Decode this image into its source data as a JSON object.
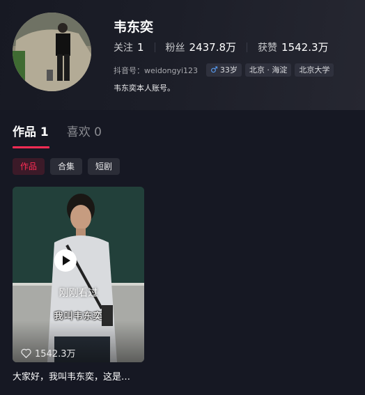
{
  "profile": {
    "name": "韦东奕",
    "stats": [
      {
        "label": "关注",
        "value": "1"
      },
      {
        "label": "粉丝",
        "value": "2437.8万"
      },
      {
        "label": "获赞",
        "value": "1542.3万"
      }
    ],
    "douyin_id": "抖音号：weidongyi123",
    "age": "33岁",
    "location": "北京 · 海淀",
    "school": "北京大学",
    "bio": "韦东奕本人账号。"
  },
  "tabs": [
    {
      "label": "作品 1",
      "active": true
    },
    {
      "label": "喜欢 0",
      "active": false
    }
  ],
  "filters": [
    {
      "label": "作品",
      "active": true
    },
    {
      "label": "合集",
      "active": false
    },
    {
      "label": "短剧",
      "active": false
    }
  ],
  "video": {
    "watched_label": "刚刚看过",
    "subtitle": "我叫韦东奕",
    "likes": "1542.3万",
    "description": "大家好，我叫韦东奕，这是…"
  },
  "colors": {
    "background": "#161823",
    "accent": "#fe2c55",
    "gender_icon": "#5aa3ff"
  },
  "icons": {
    "gender": "male-icon",
    "play": "play-icon",
    "like": "heart-icon"
  }
}
